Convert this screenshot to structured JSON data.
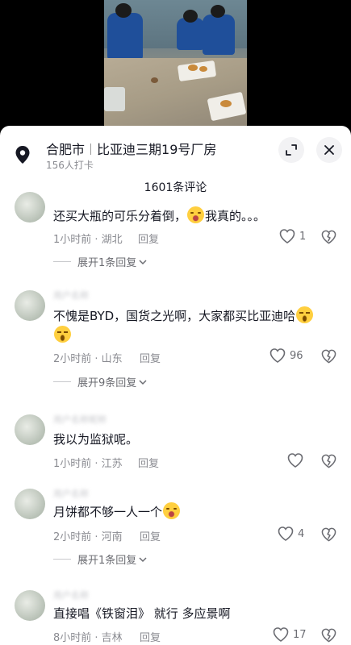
{
  "location": {
    "city": "合肥市",
    "place": "比亚迪三期19号厂房",
    "checkins": "156人打卡"
  },
  "comment_count": "1601条评论",
  "reply_label": "回复",
  "comments": [
    {
      "text_parts": [
        "还买大瓶的可乐分着倒，",
        "我真的。。。"
      ],
      "emojis": [
        "cry"
      ],
      "time_place": "1小时前 · 湖北",
      "likes": "1",
      "expand": "展开1条回复"
    },
    {
      "text_parts": [
        "不愧是BYD，国货之光啊，大家都买比亚迪哈",
        ""
      ],
      "emojis": [
        "smirk",
        "smirk"
      ],
      "time_place": "2小时前 · 山东",
      "likes": "96",
      "expand": "展开9条回复"
    },
    {
      "text_parts": [
        "我以为监狱呢。"
      ],
      "emojis": [],
      "time_place": "1小时前 · 江苏",
      "likes": "",
      "expand": ""
    },
    {
      "text_parts": [
        "月饼都不够一人一个"
      ],
      "emojis": [
        "cry"
      ],
      "time_place": "2小时前 · 河南",
      "likes": "4",
      "expand": "展开1条回复"
    },
    {
      "text_parts": [
        "直接唱《铁窗泪》 就行 多应景啊"
      ],
      "emojis": [],
      "time_place": "8小时前 · 吉林",
      "likes": "17",
      "expand": ""
    }
  ]
}
